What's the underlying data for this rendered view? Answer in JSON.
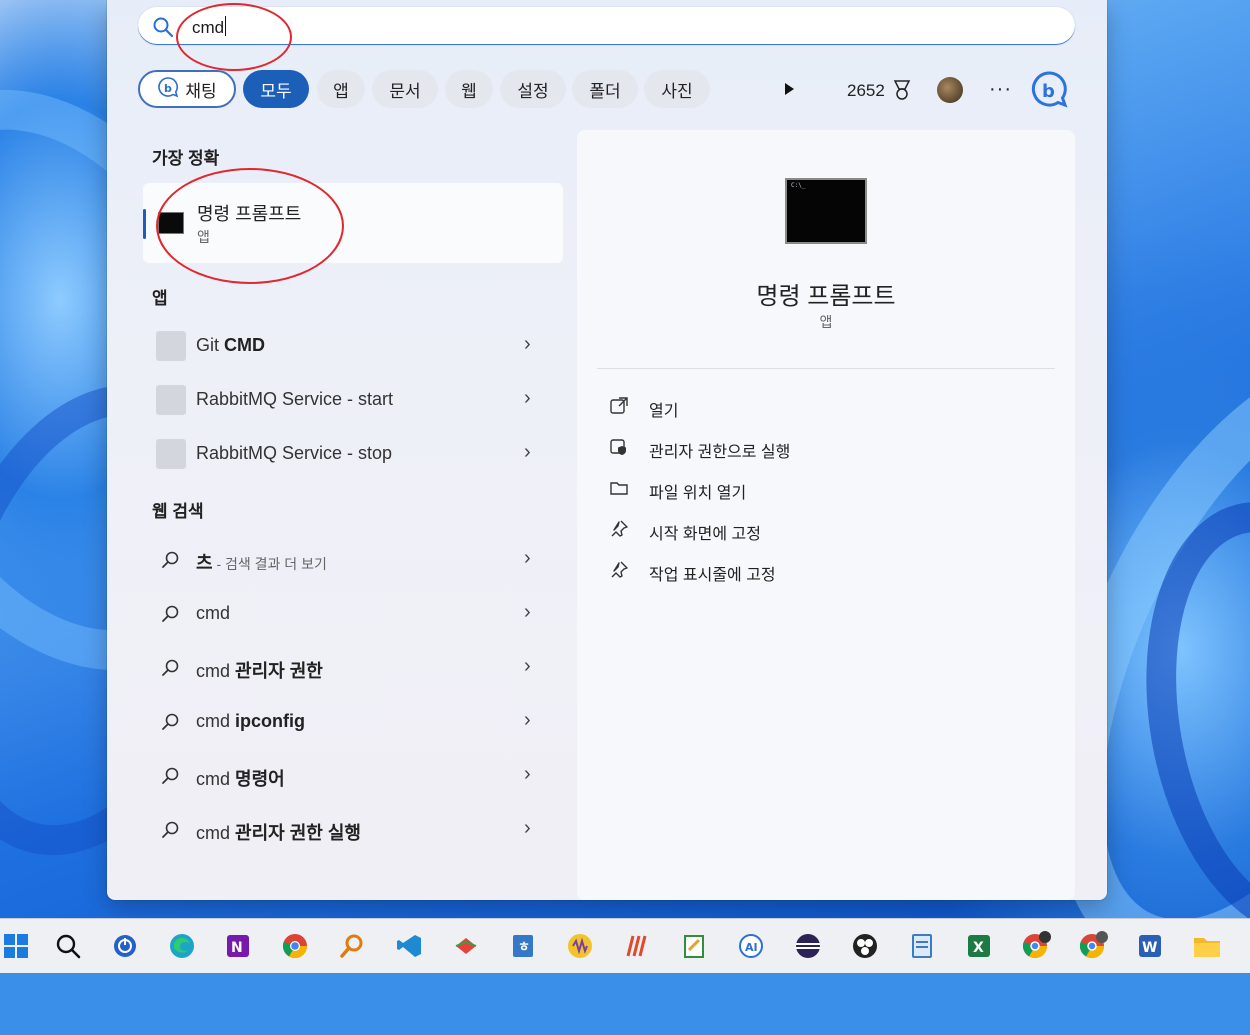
{
  "search": {
    "query": "cmd"
  },
  "filters": {
    "chat": "채팅",
    "all": "모두",
    "apps": "앱",
    "documents": "문서",
    "web": "웹",
    "settings": "설정",
    "folders": "폴더",
    "photos": "사진"
  },
  "rewards": {
    "points": "2652"
  },
  "best_match": {
    "section": "가장 정확",
    "name": "명령 프롬프트",
    "type": "앱"
  },
  "apps": {
    "section": "앱",
    "items": [
      {
        "normal": "Git ",
        "bold": "CMD"
      },
      {
        "normal": "RabbitMQ Service - start",
        "bold": ""
      },
      {
        "normal": "RabbitMQ Service - stop",
        "bold": ""
      }
    ]
  },
  "web_search": {
    "section": "웹 검색",
    "first": {
      "term": "츠",
      "sub": " - 검색 결과 더 보기"
    },
    "items": [
      {
        "normal": "cmd",
        "bold": ""
      },
      {
        "normal": "cmd ",
        "bold": "관리자 권한"
      },
      {
        "normal": "cmd ",
        "bold": "ipconfig"
      },
      {
        "normal": "cmd ",
        "bold": "명령어"
      },
      {
        "normal": "cmd ",
        "bold": "관리자 권한 실행"
      }
    ]
  },
  "detail": {
    "title": "명령 프롬프트",
    "subtitle": "앱",
    "actions": [
      "열기",
      "관리자 권한으로 실행",
      "파일 위치 열기",
      "시작 화면에 고정",
      "작업 표시줄에 고정"
    ]
  },
  "colors": {
    "accent": "#1c5fb8",
    "highlight_circle": "#e0282e"
  },
  "taskbar_icons": [
    "windows-start-icon",
    "search-icon",
    "power-automate-icon",
    "edge-icon",
    "onenote-icon",
    "chrome-icon",
    "search-everything-icon",
    "vscode-icon",
    "kite-icon",
    "hwp-icon",
    "audio-icon",
    "pen-icon",
    "notepad-icon",
    "app-icon",
    "eclipse-icon",
    "obs-icon",
    "notepad-plus-icon",
    "excel-icon",
    "chrome-profile-icon",
    "chrome-profile-2-icon",
    "word-icon",
    "file-explorer-icon"
  ]
}
